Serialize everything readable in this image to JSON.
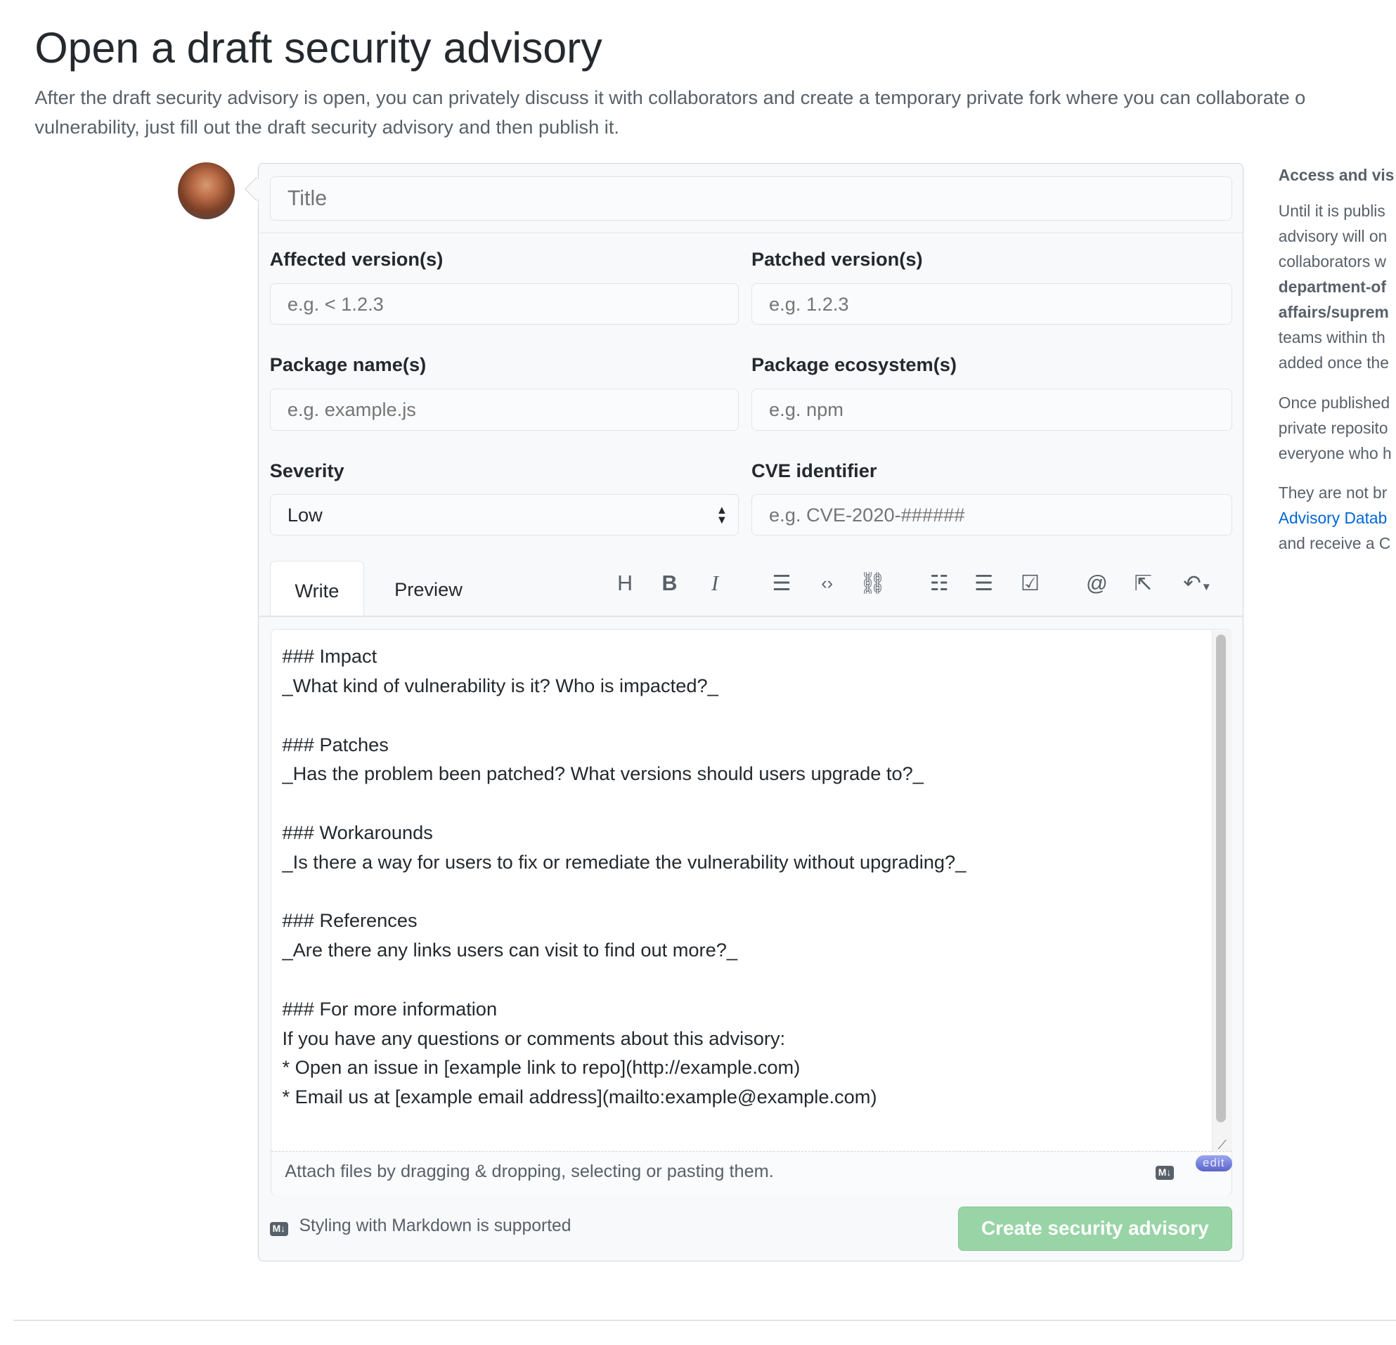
{
  "header": {
    "title": "Open a draft security advisory",
    "description": "After the draft security advisory is open, you can privately discuss it with collaborators and create a temporary private fork where you can collaborate on a fix. If you've already fixed the vulnerability, just fill out the draft security advisory and then publish it.",
    "description_line1": "After the draft security advisory is open, you can privately discuss it with collaborators and create a temporary private fork where you can collaborate o",
    "description_line2": "vulnerability, just fill out the draft security advisory and then publish it."
  },
  "form": {
    "title_placeholder": "Title",
    "affected_label": "Affected version(s)",
    "affected_placeholder": "e.g. < 1.2.3",
    "patched_label": "Patched version(s)",
    "patched_placeholder": "e.g. 1.2.3",
    "package_label": "Package name(s)",
    "package_placeholder": "e.g. example.js",
    "ecosystem_label": "Package ecosystem(s)",
    "ecosystem_placeholder": "e.g. npm",
    "severity_label": "Severity",
    "severity_value": "Low",
    "cve_label": "CVE identifier",
    "cve_placeholder": "e.g. CVE-2020-######"
  },
  "editor": {
    "tabs": [
      "Write",
      "Preview"
    ],
    "toolbar_icons": [
      "heading-icon",
      "bold-icon",
      "italic-icon",
      "quote-icon",
      "code-icon",
      "link-icon",
      "unordered-list-icon",
      "ordered-list-icon",
      "task-list-icon",
      "mention-icon",
      "cross-reference-icon",
      "reply-icon"
    ],
    "body": "### Impact\n_What kind of vulnerability is it? Who is impacted?_\n\n### Patches\n_Has the problem been patched? What versions should users upgrade to?_\n\n### Workarounds\n_Is there a way for users to fix or remediate the vulnerability without upgrading?_\n\n### References\n_Are there any links users can visit to find out more?_\n\n### For more information\nIf you have any questions or comments about this advisory:\n* Open an issue in [example link to repo](http://example.com)\n* Email us at [example email address](mailto:example@example.com)",
    "attach_text": "Attach files by dragging & dropping, selecting or pasting them.",
    "md_badge": "M↓",
    "edit_badge": "edit"
  },
  "footer": {
    "markdown_note": "Styling with Markdown is supported",
    "submit_label": "Create security advisory",
    "submit_color": "#94d3a2"
  },
  "sidebar": {
    "heading": "Access and vis",
    "p1": [
      "Until it is publis",
      "advisory will on",
      "collaborators w"
    ],
    "p1_bold": [
      "department-of",
      "affairs/suprem"
    ],
    "p1_end": [
      "teams within th",
      "added once the"
    ],
    "p2": [
      "Once published",
      "private reposito",
      "everyone who h"
    ],
    "p3_start": "They are not br",
    "p3_link": "Advisory Datab",
    "p3_end": "and receive a C",
    "link_color": "#0366d6"
  }
}
